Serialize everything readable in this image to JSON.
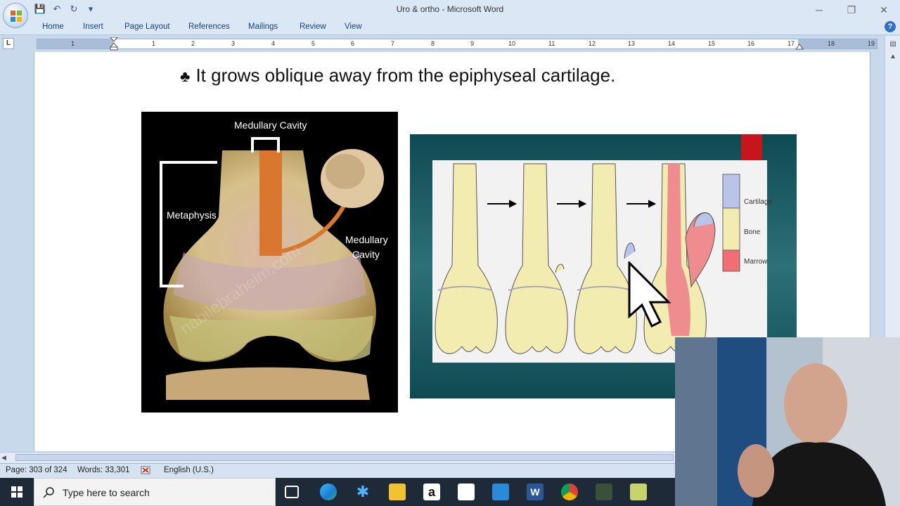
{
  "window": {
    "title": "Uro & ortho - Microsoft Word",
    "minimize": "─",
    "restore": "❐",
    "close": "✕"
  },
  "qat": {
    "save": "💾",
    "undo": "↶",
    "redo": "↻",
    "more": "▾"
  },
  "ribbon_tabs": [
    "Home",
    "Insert",
    "Page Layout",
    "References",
    "Mailings",
    "Review",
    "View"
  ],
  "help": "?",
  "tab_stop": "L",
  "ruler_numbers": [
    "1",
    "1",
    "2",
    "3",
    "4",
    "5",
    "6",
    "7",
    "8",
    "9",
    "10",
    "11",
    "12",
    "13",
    "14",
    "15",
    "16",
    "17",
    "18",
    "19"
  ],
  "document": {
    "bullet": "♣",
    "heading": "It grows oblique away from the epiphyseal cartilage."
  },
  "figure_left": {
    "label_top": "Medullary Cavity",
    "label_metaphysis": "Metaphysis",
    "label_medullary_1": "Medullary",
    "label_medullary_2": "Cavity",
    "watermark": "nabilebraheim.com"
  },
  "figure_right": {
    "legend": [
      "Cartilage",
      "Bone",
      "Marrow"
    ],
    "legend_colors": [
      "#b9c4e8",
      "#f3ecb0",
      "#ef6f74"
    ],
    "arrows": [
      "→",
      "→",
      "→"
    ]
  },
  "status": {
    "page": "Page: 303 of 324",
    "words": "Words: 33,301",
    "language": "English (U.S.)"
  },
  "taskbar": {
    "search_placeholder": "Type here to search",
    "icons": [
      "windows-start-icon",
      "task-view-icon",
      "edge-icon",
      "bluetooth-icon",
      "file-explorer-icon",
      "amazon-icon",
      "store-icon",
      "mail-icon",
      "word-icon",
      "chrome-icon",
      "camera-app-icon",
      "notes-icon"
    ]
  }
}
